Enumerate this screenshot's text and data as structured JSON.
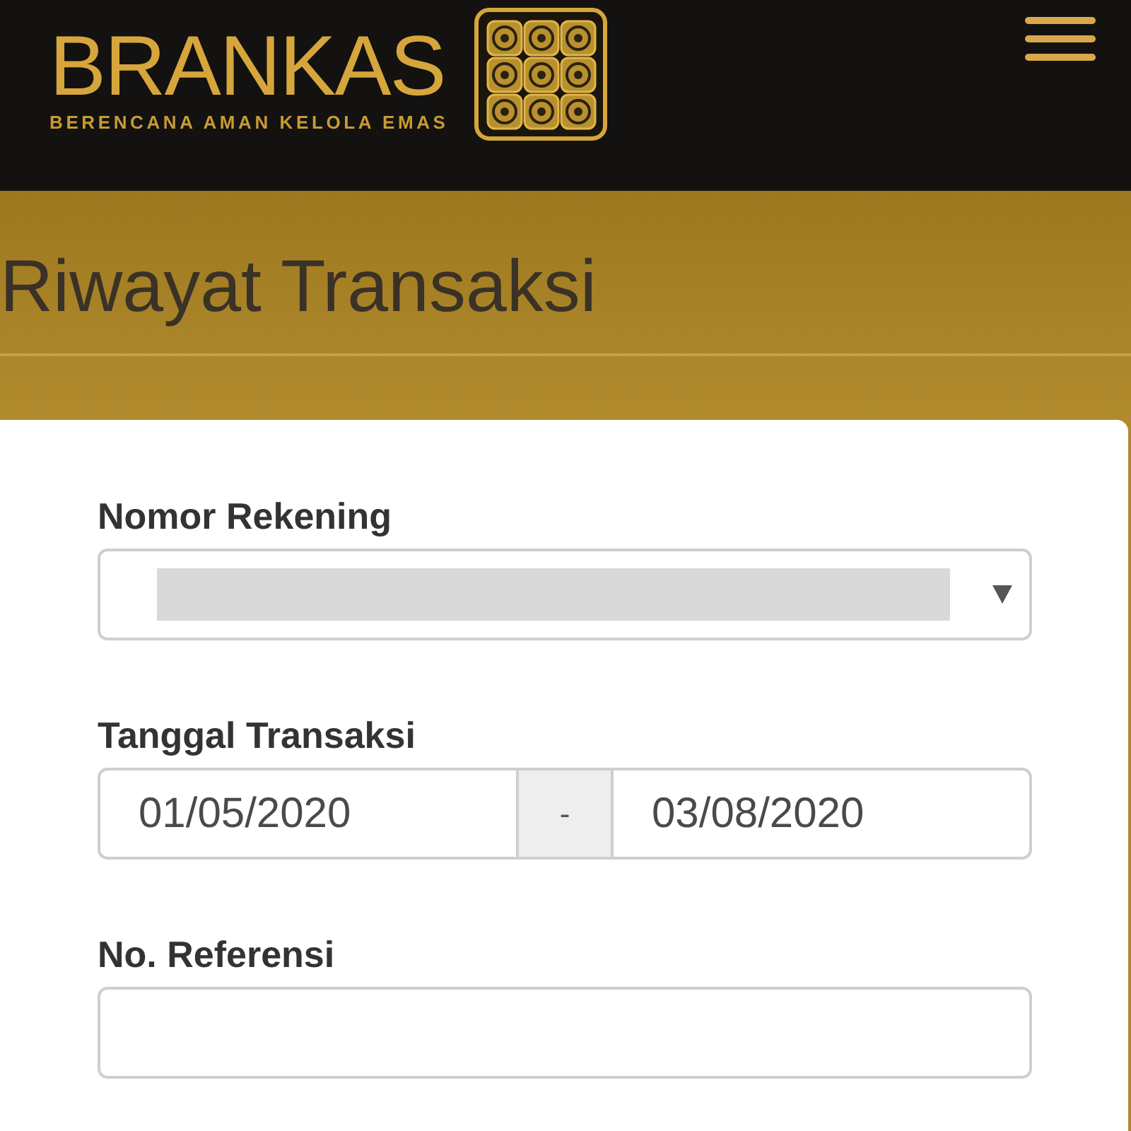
{
  "header": {
    "brand": "BRANKAS",
    "tagline": "BERENCANA AMAN KELOLA EMAS"
  },
  "page_title": "Riwayat Transaksi",
  "form": {
    "fields": [
      {
        "kind": "select",
        "label": "Nomor Rekening",
        "redacted": true
      },
      {
        "kind": "date_range",
        "label": "Tanggal Transaksi",
        "from": "01/05/2020",
        "separator": "-",
        "to": "03/08/2020"
      },
      {
        "kind": "text",
        "label": "No. Referensi"
      }
    ]
  }
}
